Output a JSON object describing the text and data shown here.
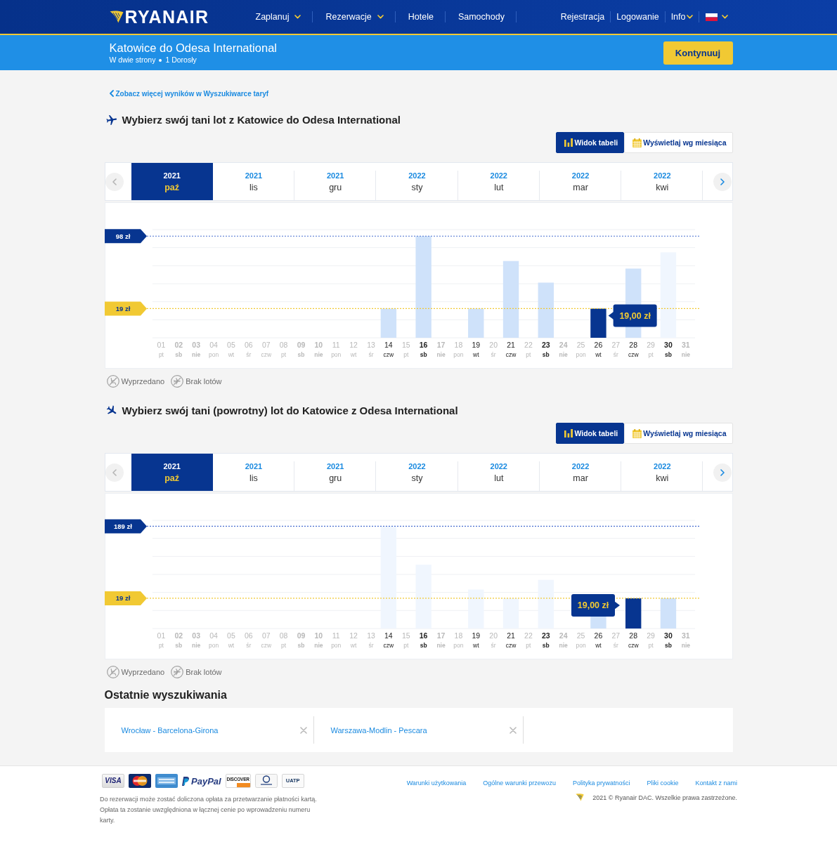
{
  "header": {
    "logo": "RYANAIR",
    "nav": [
      {
        "label": "Zaplanuj",
        "has_menu": true
      },
      {
        "label": "Rezerwacje",
        "has_menu": true
      },
      {
        "label": "Hotele",
        "has_menu": false
      },
      {
        "label": "Samochody",
        "has_menu": false
      }
    ],
    "account": [
      {
        "label": "Rejestracja",
        "has_menu": false
      },
      {
        "label": "Logowanie",
        "has_menu": false
      },
      {
        "label": "Info",
        "has_menu": true
      }
    ]
  },
  "trip": {
    "title": "Katowice do Odesa International",
    "details": [
      "W dwie strony",
      "1 Dorosły"
    ],
    "button": "Kontynuuj"
  },
  "back_link": "Zobacz więcej wyników w Wyszukiwarce taryf",
  "flights": [
    {
      "title": "Wybierz swój tani lot z Katowice do Odesa International",
      "views": [
        {
          "label": "Widok tabeli",
          "selected": true
        },
        {
          "label": "Wyświetlaj wg miesiąca",
          "selected": false
        }
      ],
      "months": [
        {
          "year": "2021",
          "month": "paź",
          "selected": true
        },
        {
          "year": "2021",
          "month": "lis",
          "selected": false
        },
        {
          "year": "2021",
          "month": "gru",
          "selected": false
        },
        {
          "year": "2022",
          "month": "sty",
          "selected": false
        },
        {
          "year": "2022",
          "month": "lut",
          "selected": false
        },
        {
          "year": "2022",
          "month": "mar",
          "selected": false
        },
        {
          "year": "2022",
          "month": "kwi",
          "selected": false
        }
      ],
      "prev_disabled": true,
      "next_disabled": false,
      "price_markers": [
        {
          "kind": "max",
          "label": "98 zł"
        },
        {
          "kind": "min",
          "label": "19 zł"
        }
      ],
      "days": [
        {
          "day": "01",
          "weekday": "pt",
          "weekend": false
        },
        {
          "day": "02",
          "weekday": "sb",
          "weekend": true
        },
        {
          "day": "03",
          "weekday": "nie",
          "weekend": true
        },
        {
          "day": "04",
          "weekday": "pon",
          "weekend": false
        },
        {
          "day": "05",
          "weekday": "wt",
          "weekend": false
        },
        {
          "day": "06",
          "weekday": "śr",
          "weekend": false
        },
        {
          "day": "07",
          "weekday": "czw",
          "weekend": false
        },
        {
          "day": "08",
          "weekday": "pt",
          "weekend": false
        },
        {
          "day": "09",
          "weekday": "sb",
          "weekend": true
        },
        {
          "day": "10",
          "weekday": "nie",
          "weekend": true
        },
        {
          "day": "11",
          "weekday": "pon",
          "weekend": false
        },
        {
          "day": "12",
          "weekday": "wt",
          "weekend": false
        },
        {
          "day": "13",
          "weekday": "śr",
          "weekend": false
        },
        {
          "day": "14",
          "weekday": "czw",
          "weekend": false,
          "level": 0.27,
          "selected": false,
          "faded": false
        },
        {
          "day": "15",
          "weekday": "pt",
          "weekend": false
        },
        {
          "day": "16",
          "weekday": "sb",
          "weekend": true,
          "level": 0.94,
          "selected": false,
          "faded": false
        },
        {
          "day": "17",
          "weekday": "nie",
          "weekend": true
        },
        {
          "day": "18",
          "weekday": "pon",
          "weekend": false
        },
        {
          "day": "19",
          "weekday": "wt",
          "weekend": false,
          "level": 0.27,
          "selected": false,
          "faded": false
        },
        {
          "day": "20",
          "weekday": "śr",
          "weekend": false
        },
        {
          "day": "21",
          "weekday": "czw",
          "weekend": false,
          "level": 0.71,
          "selected": false,
          "faded": false
        },
        {
          "day": "22",
          "weekday": "pt",
          "weekend": false
        },
        {
          "day": "23",
          "weekday": "sb",
          "weekend": true,
          "level": 0.51,
          "selected": false,
          "faded": false
        },
        {
          "day": "24",
          "weekday": "nie",
          "weekend": true
        },
        {
          "day": "25",
          "weekday": "pon",
          "weekend": false
        },
        {
          "day": "26",
          "weekday": "wt",
          "weekend": false,
          "level": 0.27,
          "selected": true,
          "faded": false
        },
        {
          "day": "27",
          "weekday": "śr",
          "weekend": false
        },
        {
          "day": "28",
          "weekday": "czw",
          "weekend": false,
          "level": 0.64,
          "selected": false,
          "faded": false
        },
        {
          "day": "29",
          "weekday": "pt",
          "weekend": false
        },
        {
          "day": "30",
          "weekday": "sb",
          "weekend": true,
          "level": 0.79,
          "selected": false,
          "faded": true
        },
        {
          "day": "31",
          "weekday": "nie",
          "weekend": true
        }
      ],
      "tooltip": {
        "label": "19,00 zł",
        "left": false
      },
      "legend": [
        "Wyprzedano",
        "Brak lotów"
      ]
    },
    {
      "title": "Wybierz swój tani (powrotny) lot do Katowice z Odesa International",
      "views": [
        {
          "label": "Widok tabeli",
          "selected": true
        },
        {
          "label": "Wyświetlaj wg miesiąca",
          "selected": false
        }
      ],
      "months": [
        {
          "year": "2021",
          "month": "paź",
          "selected": true
        },
        {
          "year": "2021",
          "month": "lis",
          "selected": false
        },
        {
          "year": "2021",
          "month": "gru",
          "selected": false
        },
        {
          "year": "2022",
          "month": "sty",
          "selected": false
        },
        {
          "year": "2022",
          "month": "lut",
          "selected": false
        },
        {
          "year": "2022",
          "month": "mar",
          "selected": false
        },
        {
          "year": "2022",
          "month": "kwi",
          "selected": false
        }
      ],
      "prev_disabled": true,
      "next_disabled": false,
      "price_markers": [
        {
          "kind": "max",
          "label": "189 zł"
        },
        {
          "kind": "min",
          "label": "19 zł"
        }
      ],
      "days": [
        {
          "day": "01",
          "weekday": "pt",
          "weekend": false
        },
        {
          "day": "02",
          "weekday": "sb",
          "weekend": true
        },
        {
          "day": "03",
          "weekday": "nie",
          "weekend": true
        },
        {
          "day": "04",
          "weekday": "pon",
          "weekend": false
        },
        {
          "day": "05",
          "weekday": "wt",
          "weekend": false
        },
        {
          "day": "06",
          "weekday": "śr",
          "weekend": false
        },
        {
          "day": "07",
          "weekday": "czw",
          "weekend": false
        },
        {
          "day": "08",
          "weekday": "pt",
          "weekend": false
        },
        {
          "day": "09",
          "weekday": "sb",
          "weekend": true
        },
        {
          "day": "10",
          "weekday": "nie",
          "weekend": true
        },
        {
          "day": "11",
          "weekday": "pon",
          "weekend": false
        },
        {
          "day": "12",
          "weekday": "wt",
          "weekend": false
        },
        {
          "day": "13",
          "weekday": "śr",
          "weekend": false
        },
        {
          "day": "14",
          "weekday": "czw",
          "weekend": false,
          "level": 0.945,
          "selected": false,
          "faded": true
        },
        {
          "day": "15",
          "weekday": "pt",
          "weekend": false
        },
        {
          "day": "16",
          "weekday": "sb",
          "weekend": true,
          "level": 0.59,
          "selected": false,
          "faded": true
        },
        {
          "day": "17",
          "weekday": "nie",
          "weekend": true
        },
        {
          "day": "18",
          "weekday": "pon",
          "weekend": false
        },
        {
          "day": "19",
          "weekday": "wt",
          "weekend": false,
          "level": 0.36,
          "selected": false,
          "faded": true
        },
        {
          "day": "20",
          "weekday": "śr",
          "weekend": false
        },
        {
          "day": "21",
          "weekday": "czw",
          "weekend": false,
          "level": 0.28,
          "selected": false,
          "faded": true
        },
        {
          "day": "22",
          "weekday": "pt",
          "weekend": false
        },
        {
          "day": "23",
          "weekday": "sb",
          "weekend": true,
          "level": 0.45,
          "selected": false,
          "faded": true
        },
        {
          "day": "24",
          "weekday": "nie",
          "weekend": true
        },
        {
          "day": "25",
          "weekday": "pon",
          "weekend": false
        },
        {
          "day": "26",
          "weekday": "wt",
          "weekend": false,
          "level": 0.28,
          "selected": false,
          "faded": false
        },
        {
          "day": "27",
          "weekday": "śr",
          "weekend": false
        },
        {
          "day": "28",
          "weekday": "czw",
          "weekend": false,
          "level": 0.28,
          "selected": true,
          "faded": false
        },
        {
          "day": "29",
          "weekday": "pt",
          "weekend": false
        },
        {
          "day": "30",
          "weekday": "sb",
          "weekend": true,
          "level": 0.28,
          "selected": false,
          "faded": false
        },
        {
          "day": "31",
          "weekday": "nie",
          "weekend": true
        }
      ],
      "tooltip": {
        "label": "19,00 zł",
        "left": true
      },
      "legend": [
        "Wyprzedano",
        "Brak lotów"
      ]
    }
  ],
  "recent_searches": {
    "title": "Ostatnie wyszukiwania",
    "items": [
      "Wrocław - Barcelona-Girona",
      "Warszawa-Modlin - Pescara"
    ]
  },
  "footer": {
    "payment_logos": [
      {
        "kind": "visa",
        "label": "VISA"
      },
      {
        "kind": "mastercard"
      },
      {
        "kind": "amex"
      },
      {
        "kind": "paypal",
        "label": "PayPal"
      },
      {
        "kind": "discover",
        "label": "DISCOVER"
      },
      {
        "kind": "diners"
      },
      {
        "kind": "uatp",
        "label": "UATP"
      }
    ],
    "note": "Do rezerwacji może zostać doliczona opłata za przetwarzanie płatności kartą. Opłata ta zostanie uwzględniona w łącznej cenie po wprowadzeniu numeru karty.",
    "links": [
      "Warunki użytkowania",
      "Ogólne warunki przewozu",
      "Polityka prywatności",
      "Pliki cookie",
      "Kontakt z nami"
    ],
    "copyright": "2021 © Ryanair DAC. Wszelkie prawa zastrzeżone."
  }
}
